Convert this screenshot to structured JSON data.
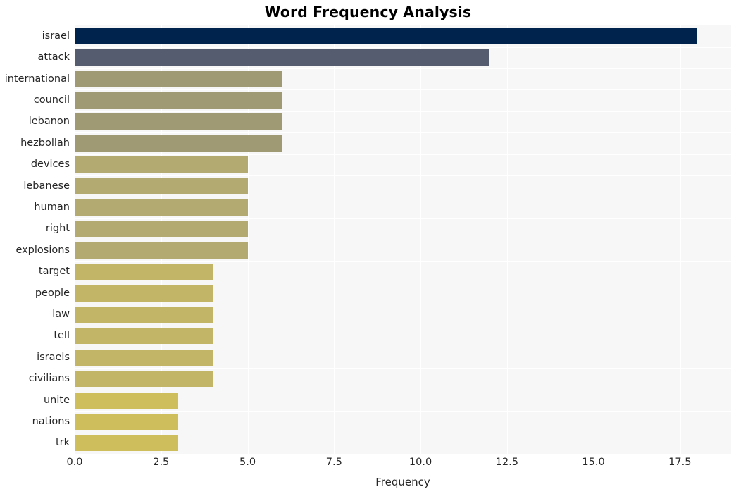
{
  "chart_data": {
    "type": "bar",
    "orientation": "horizontal",
    "title": "Word Frequency Analysis",
    "xlabel": "Frequency",
    "ylabel": "",
    "xlim": [
      0,
      18.98
    ],
    "xticks": [
      "0.0",
      "2.5",
      "5.0",
      "7.5",
      "10.0",
      "12.5",
      "15.0",
      "17.5"
    ],
    "xtick_values": [
      0,
      2.5,
      5,
      7.5,
      10,
      12.5,
      15,
      17.5
    ],
    "grid": "vertical-white-on-gray",
    "legend": "none",
    "categories": [
      "israel",
      "attack",
      "international",
      "council",
      "lebanon",
      "hezbollah",
      "devices",
      "lebanese",
      "human",
      "right",
      "explosions",
      "target",
      "people",
      "law",
      "tell",
      "israels",
      "civilians",
      "unite",
      "nations",
      "trk"
    ],
    "values": [
      18,
      12,
      6,
      6,
      6,
      6,
      5,
      5,
      5,
      5,
      5,
      4,
      4,
      4,
      4,
      4,
      4,
      3,
      3,
      3
    ],
    "bar_colors": [
      "#00234d",
      "#555c70",
      "#a09a74",
      "#a09a74",
      "#a09a74",
      "#a09a74",
      "#b3aa71",
      "#b3aa71",
      "#b3aa71",
      "#b3aa71",
      "#b3aa71",
      "#c3b568",
      "#c3b568",
      "#c3b568",
      "#c3b568",
      "#c3b568",
      "#c3b568",
      "#cfbe5c",
      "#cfbe5c",
      "#cfbe5c"
    ],
    "plot_background": "#f7f7f7",
    "gridline_color": "#ffffff",
    "text_color": "#262626",
    "page_background": "#ffffff"
  }
}
